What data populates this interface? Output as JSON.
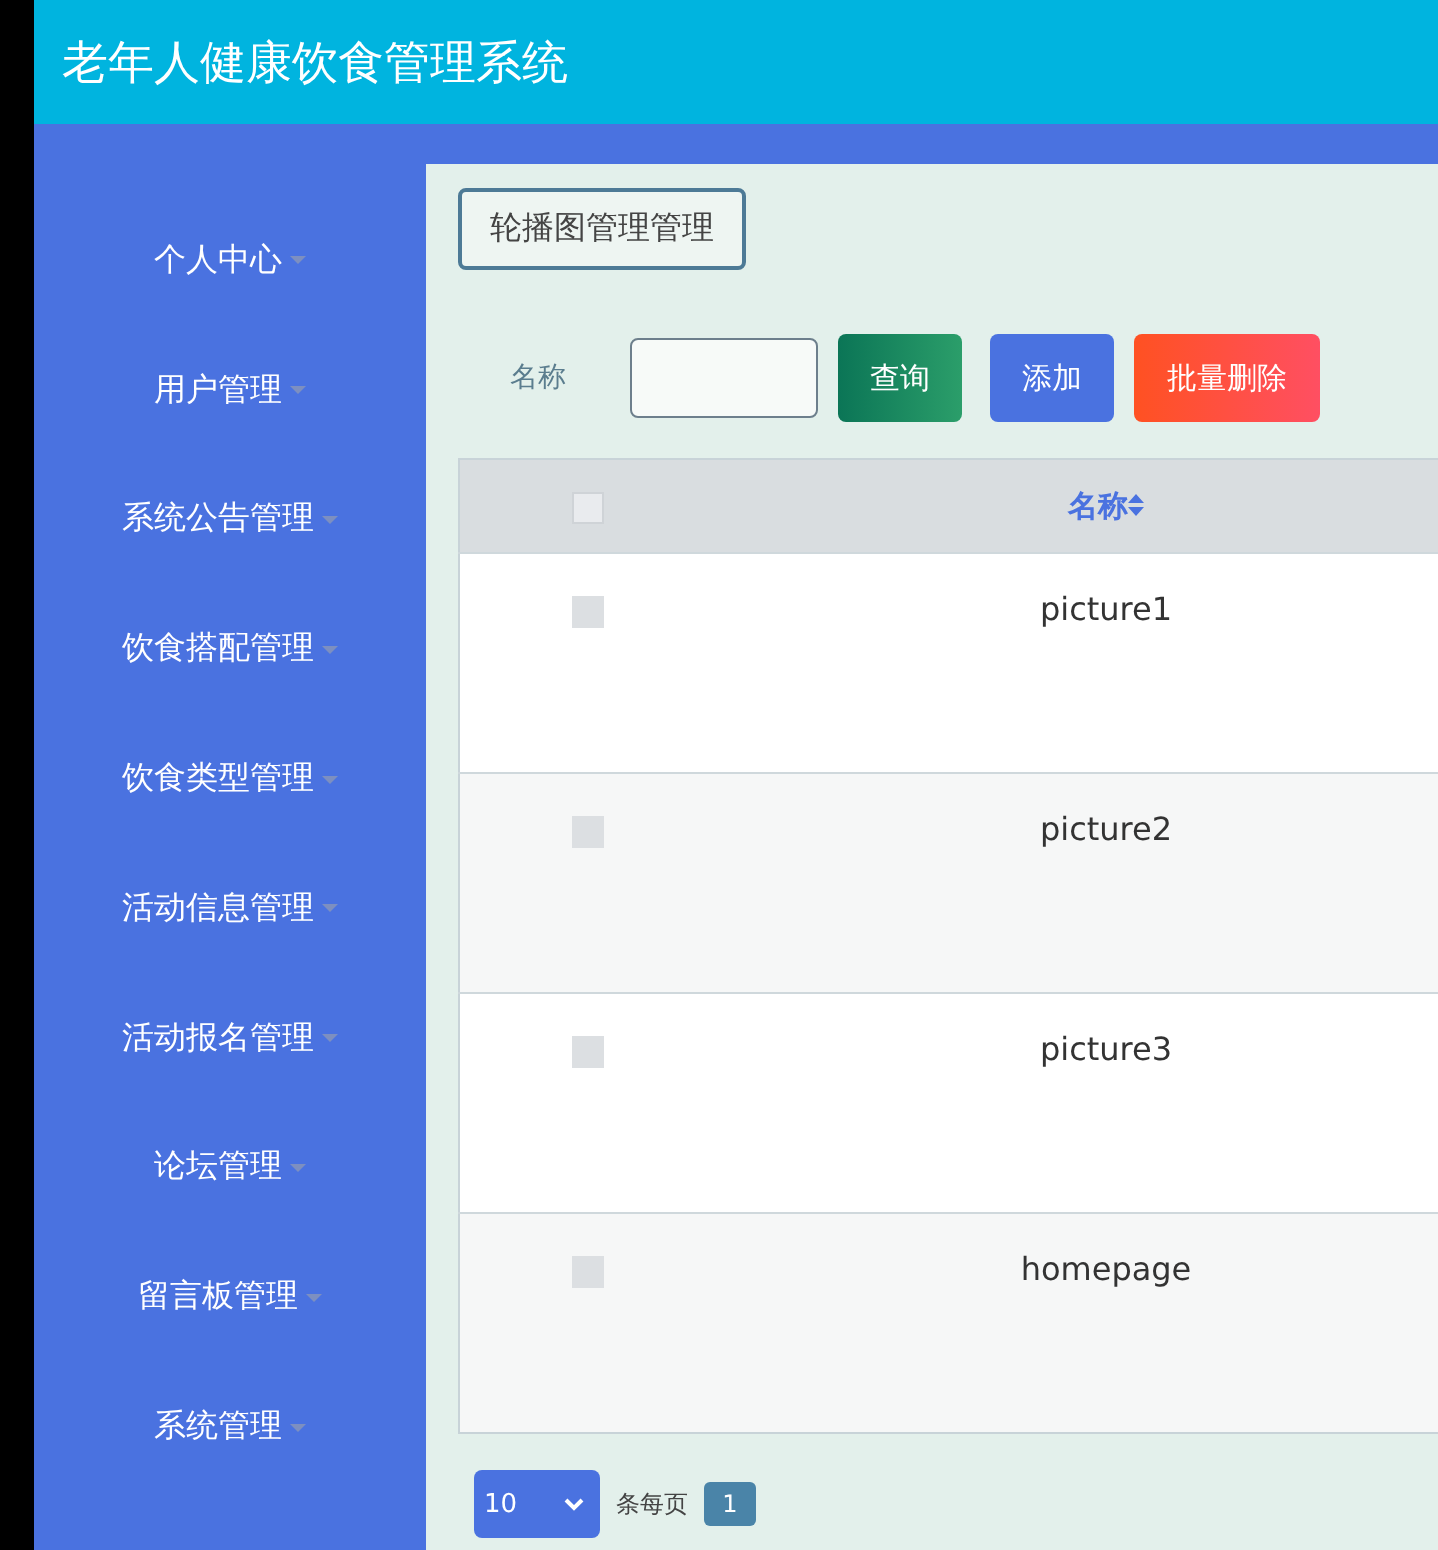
{
  "header": {
    "title": "老年人健康饮食管理系统"
  },
  "sidebar": {
    "items": [
      {
        "label": "个人中心",
        "expanded": false
      },
      {
        "label": "用户管理",
        "expanded": false
      },
      {
        "label": "系统公告管理",
        "expanded": false
      },
      {
        "label": "饮食搭配管理",
        "expanded": false
      },
      {
        "label": "饮食类型管理",
        "expanded": false
      },
      {
        "label": "活动信息管理",
        "expanded": false
      },
      {
        "label": "活动报名管理",
        "expanded": false
      },
      {
        "label": "论坛管理",
        "expanded": false
      },
      {
        "label": "留言板管理",
        "expanded": false
      },
      {
        "label": "系统管理",
        "expanded": false
      }
    ]
  },
  "breadcrumb": "轮播图管理管理",
  "search": {
    "label": "名称"
  },
  "buttons": [
    {
      "kind": "search",
      "label": "查询"
    },
    {
      "kind": "add",
      "label": "添加"
    },
    {
      "kind": "delete",
      "label": "批量删除"
    }
  ],
  "table": {
    "select_all": {
      "checked": false
    },
    "columns": [
      "名称"
    ],
    "rows": [
      {
        "checked": false,
        "cells": [
          "picture1"
        ]
      },
      {
        "checked": false,
        "cells": [
          "picture2"
        ]
      },
      {
        "checked": false,
        "cells": [
          "picture3"
        ]
      },
      {
        "checked": false,
        "cells": [
          "homepage"
        ]
      }
    ]
  },
  "pagination": {
    "page_size": "10",
    "per_page_label": "条每页",
    "pages": [
      {
        "label": "1",
        "selected": true
      }
    ]
  }
}
